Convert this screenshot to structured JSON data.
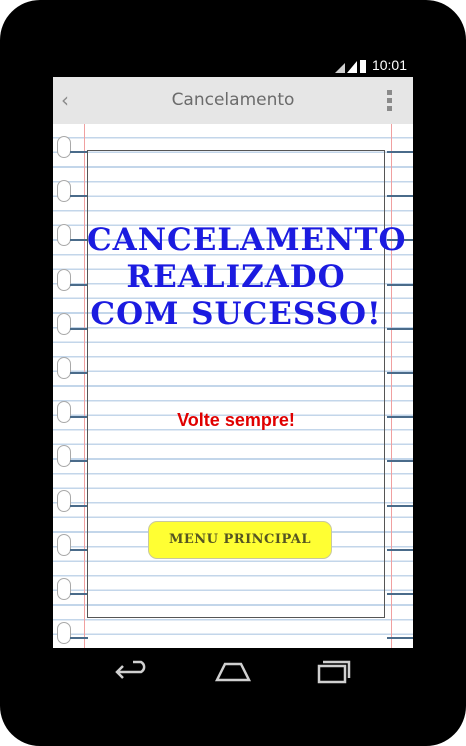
{
  "status_bar": {
    "time": "10:01",
    "icons": [
      "wifi-icon",
      "signal-icon",
      "battery-icon"
    ]
  },
  "action_bar": {
    "title": "Cancelamento",
    "back_icon": "back-chevron-icon",
    "menu_icon": "overflow-menu-icon"
  },
  "content": {
    "headline_lines": [
      "CANCELAMENTO",
      "REALIZADO",
      "COM SUCESSO!"
    ],
    "subtext": "Volte sempre!",
    "menu_button_label": "MENU PRINCIPAL"
  },
  "nav_bar": {
    "buttons": [
      "back-nav-icon",
      "home-nav-icon",
      "recents-nav-icon"
    ]
  },
  "colors": {
    "headline": "#1b1be0",
    "subtext": "#e00000",
    "button_bg": "#ffff33",
    "action_bar_bg": "#e6e6e6",
    "device_bezel": "#000000"
  }
}
